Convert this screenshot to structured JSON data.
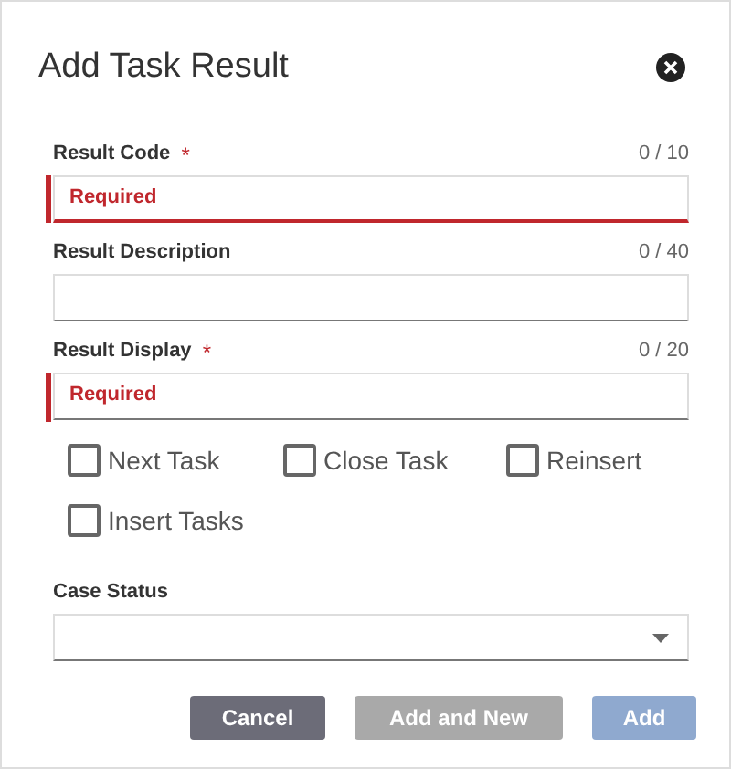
{
  "dialog": {
    "title": "Add Task Result"
  },
  "fields": [
    {
      "label": "Result Code",
      "required_mark": "*",
      "counter": "0 / 10",
      "error": "Required",
      "focused": true
    },
    {
      "label": "Result Description",
      "counter": "0 / 40",
      "focused": false
    },
    {
      "label": "Result Display",
      "required_mark": "*",
      "counter": "0 / 20",
      "error": "Required",
      "focused": false
    }
  ],
  "checkboxes": [
    {
      "label": "Next Task",
      "checked": false
    },
    {
      "label": "Close Task",
      "checked": false
    },
    {
      "label": "Reinsert",
      "checked": false
    },
    {
      "label": "Insert Tasks",
      "checked": false
    }
  ],
  "case_status": {
    "label": "Case Status"
  },
  "buttons": [
    {
      "label": "Cancel",
      "kind": "secondary",
      "disabled": false
    },
    {
      "label": "Add and New",
      "kind": "secondary",
      "disabled": true
    },
    {
      "label": "Add",
      "kind": "primary",
      "disabled": true
    }
  ]
}
